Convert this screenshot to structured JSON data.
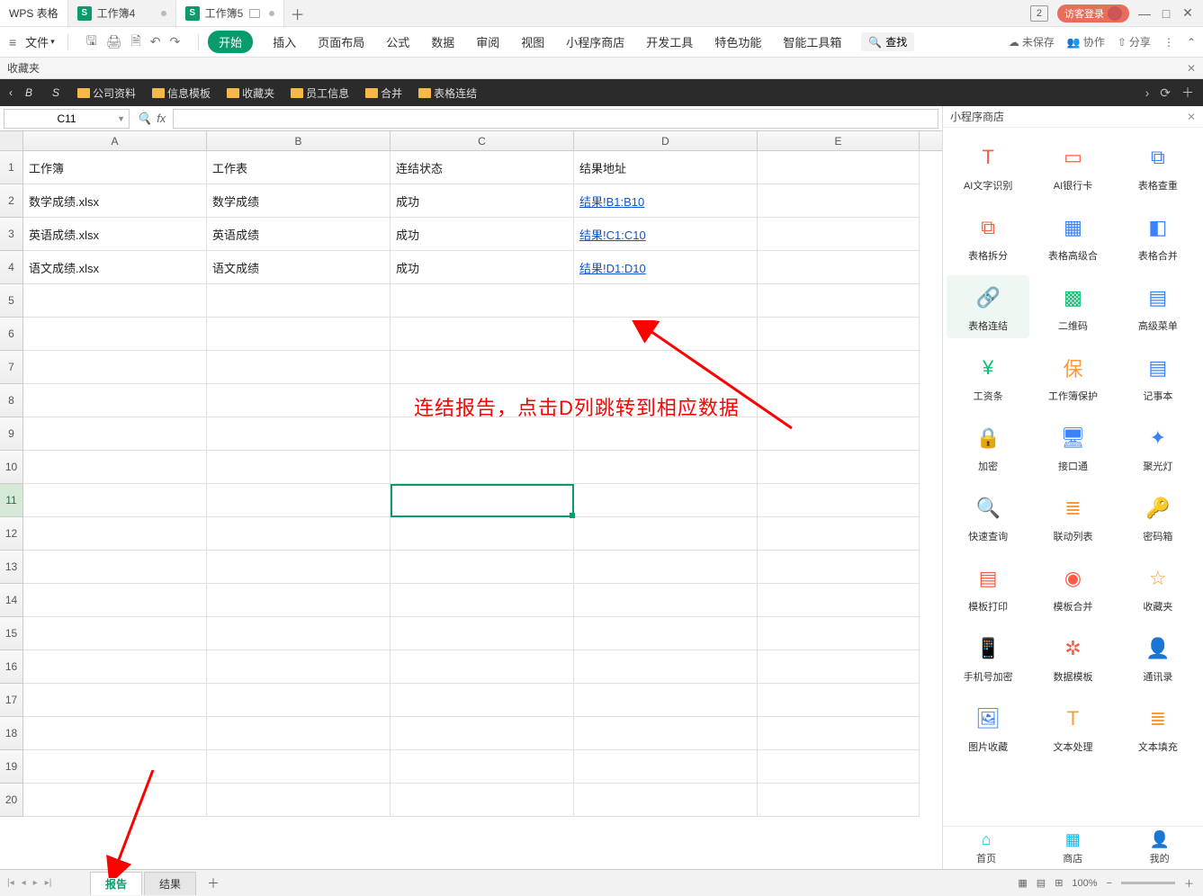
{
  "title": {
    "app": "WPS 表格",
    "tabs": [
      "工作簿4",
      "工作簿5"
    ],
    "active_tab": 1,
    "count": "2",
    "login": "访客登录"
  },
  "menu": {
    "file": "文件",
    "tabs": [
      "开始",
      "插入",
      "页面布局",
      "公式",
      "数据",
      "审阅",
      "视图",
      "小程序商店",
      "开发工具",
      "特色功能",
      "智能工具箱"
    ],
    "active": 0,
    "search": "查找",
    "right": {
      "unsaved": "未保存",
      "coop": "协作",
      "share": "分享"
    }
  },
  "fav_strip": "收藏夹",
  "darkbar": {
    "b": "B",
    "s": "S",
    "folders": [
      "公司资料",
      "信息模板",
      "收藏夹",
      "员工信息",
      "合并",
      "表格连结"
    ]
  },
  "formula": {
    "cell": "C11",
    "fx": "fx"
  },
  "columns": [
    "A",
    "B",
    "C",
    "D",
    "E"
  ],
  "rows_count": 20,
  "data": {
    "r1": {
      "A": "工作簿",
      "B": "工作表",
      "C": "连结状态",
      "D": "结果地址"
    },
    "r2": {
      "A": "数学成绩.xlsx",
      "B": "数学成绩",
      "C": "成功",
      "D": "结果!B1:B10"
    },
    "r3": {
      "A": "英语成绩.xlsx",
      "B": "英语成绩",
      "C": "成功",
      "D": "结果!C1:C10"
    },
    "r4": {
      "A": "语文成绩.xlsx",
      "B": "语文成绩",
      "C": "成功",
      "D": "结果!D1:D10"
    }
  },
  "selected": {
    "row": 11,
    "col": "C"
  },
  "annotation": "连结报告，点击D列跳转到相应数据",
  "mini_store": {
    "title": "小程序商店",
    "items": [
      {
        "label": "AI文字识别",
        "icon": "T",
        "bg": "#ff5b45"
      },
      {
        "label": "AI银行卡",
        "icon": "▭",
        "bg": "#ff5b45"
      },
      {
        "label": "表格查重",
        "icon": "⧉",
        "bg": "#3b82f6"
      },
      {
        "label": "表格拆分",
        "icon": "⧉",
        "bg": "#ff5b45"
      },
      {
        "label": "表格高级合",
        "icon": "▦",
        "bg": "#3b82f6"
      },
      {
        "label": "表格合并",
        "icon": "◧",
        "bg": "#3b82f6"
      },
      {
        "label": "表格连结",
        "icon": "🔗",
        "bg": "#0bbf6e",
        "active": true
      },
      {
        "label": "二维码",
        "icon": "▩",
        "bg": "#0bbf6e"
      },
      {
        "label": "高级菜单",
        "icon": "▤",
        "bg": "#3b82f6"
      },
      {
        "label": "工资条",
        "icon": "¥",
        "bg": "#0bbf6e"
      },
      {
        "label": "工作簿保护",
        "icon": "保",
        "bg": "#ff9a3b"
      },
      {
        "label": "记事本",
        "icon": "▤",
        "bg": "#3b82f6"
      },
      {
        "label": "加密",
        "icon": "🔒",
        "bg": "#0bbf6e"
      },
      {
        "label": "接口通",
        "icon": "🖥",
        "bg": "#3b82f6"
      },
      {
        "label": "聚光灯",
        "icon": "✦",
        "bg": "#3b82f6"
      },
      {
        "label": "快速查询",
        "icon": "🔍",
        "bg": "#0bbf6e"
      },
      {
        "label": "联动列表",
        "icon": "≣",
        "bg": "#ff9a3b"
      },
      {
        "label": "密码箱",
        "icon": "🔑",
        "bg": "#8b5cf6"
      },
      {
        "label": "模板打印",
        "icon": "▤",
        "bg": "#ff5b45"
      },
      {
        "label": "模板合并",
        "icon": "◉",
        "bg": "#ff5b45"
      },
      {
        "label": "收藏夹",
        "icon": "☆",
        "bg": "#ff9a3b"
      },
      {
        "label": "手机号加密",
        "icon": "📱",
        "bg": "#3b82f6"
      },
      {
        "label": "数据模板",
        "icon": "✲",
        "bg": "#ff5b45"
      },
      {
        "label": "通讯录",
        "icon": "👤",
        "bg": "#ff9a3b"
      },
      {
        "label": "图片收藏",
        "icon": "🖼",
        "bg": "#3b82f6"
      },
      {
        "label": "文本处理",
        "icon": "T",
        "bg": "#ff9a3b"
      },
      {
        "label": "文本填充",
        "icon": "≣",
        "bg": "#ff9a3b"
      }
    ],
    "bottom": [
      {
        "label": "首页",
        "icon": "⌂",
        "color": "#1bb6e6"
      },
      {
        "label": "商店",
        "icon": "▦",
        "color": "#1bb6e6"
      },
      {
        "label": "我的",
        "icon": "👤",
        "color": "#3b82f6"
      }
    ]
  },
  "sheets": {
    "tabs": [
      "报告",
      "结果"
    ],
    "active": 0
  },
  "status": {
    "zoom": "100%"
  }
}
